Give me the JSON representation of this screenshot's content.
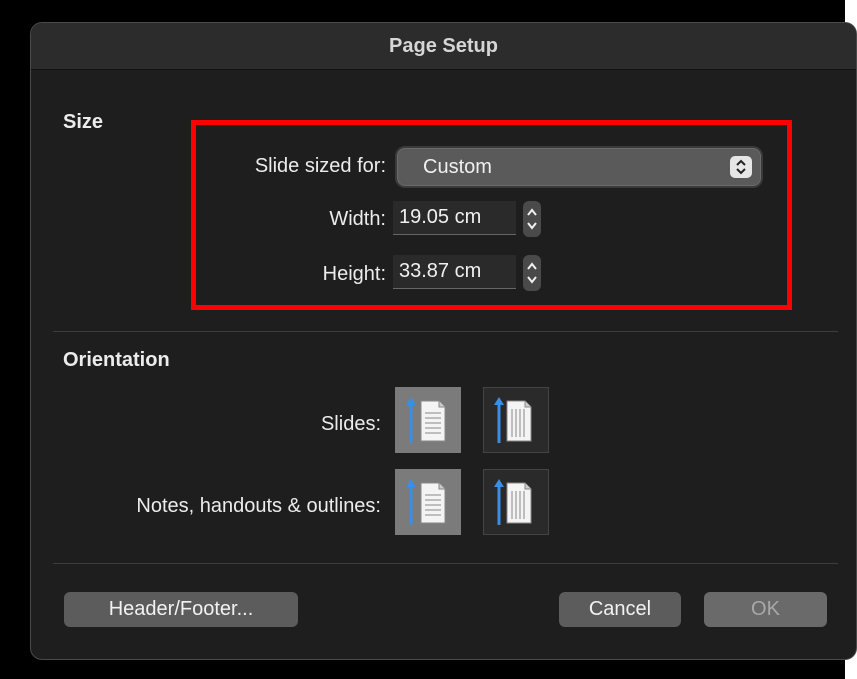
{
  "dialog": {
    "title": "Page Setup"
  },
  "size": {
    "section_title": "Size",
    "slide_sized_for_label": "Slide sized for:",
    "slide_sized_for_value": "Custom",
    "width_label": "Width:",
    "width_value": "19.05 cm",
    "height_label": "Height:",
    "height_value": "33.87 cm"
  },
  "orientation": {
    "section_title": "Orientation",
    "slides_label": "Slides:",
    "notes_label": "Notes, handouts & outlines:",
    "slides_selected": "portrait",
    "notes_selected": "portrait"
  },
  "buttons": {
    "header_footer": "Header/Footer...",
    "cancel": "Cancel",
    "ok": "OK"
  },
  "colors": {
    "highlight": "#ff0000",
    "arrow_blue": "#3a8ee6",
    "dialog_bg": "#1e1e1e"
  }
}
